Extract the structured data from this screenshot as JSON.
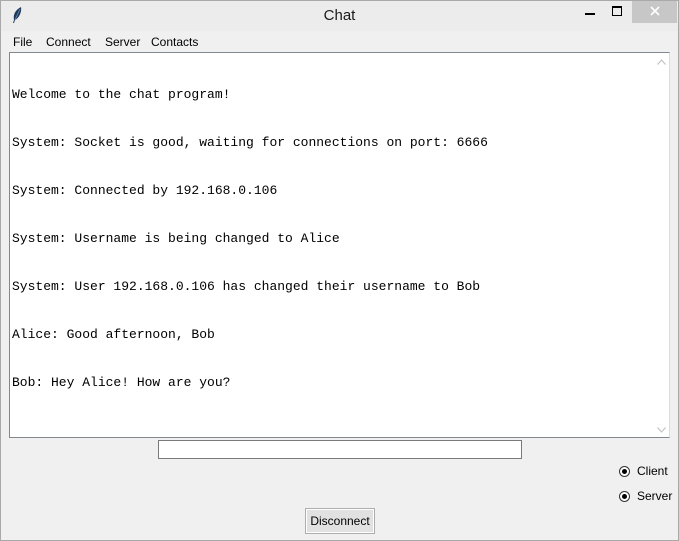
{
  "window": {
    "title": "Chat",
    "icons": {
      "app": "feather-icon",
      "minimize": "minimize-icon",
      "maximize": "maximize-icon",
      "close": "close-icon"
    }
  },
  "menu": {
    "items": [
      {
        "label": "File"
      },
      {
        "label": "Connect"
      },
      {
        "label": "Server"
      },
      {
        "label": "Contacts"
      }
    ]
  },
  "chat": {
    "lines": [
      "Welcome to the chat program!",
      "System: Socket is good, waiting for connections on port: 6666",
      "System: Connected by 192.168.0.106",
      "System: Username is being changed to Alice",
      "System: User 192.168.0.106 has changed their username to Bob",
      "Alice: Good afternoon, Bob",
      "Bob: Hey Alice! How are you?"
    ]
  },
  "input": {
    "value": "",
    "placeholder": ""
  },
  "mode": {
    "options": [
      {
        "label": "Client",
        "selected": true
      },
      {
        "label": "Server",
        "selected": true
      }
    ]
  },
  "buttons": {
    "disconnect_label": "Disconnect"
  },
  "colors": {
    "background": "#f0f0f0",
    "chat_background": "#ffffff",
    "close_button": "#c7c7c7"
  }
}
